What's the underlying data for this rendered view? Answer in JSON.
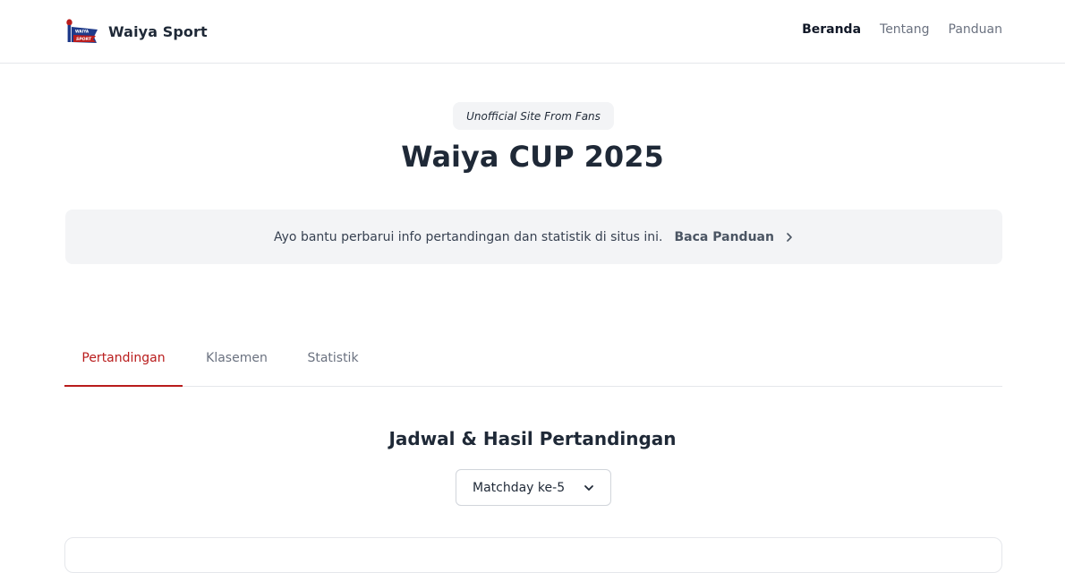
{
  "header": {
    "brand_name": "Waiya Sport",
    "logo_text_top": "WAIYA",
    "logo_text_bottom": "SPORT",
    "nav": [
      {
        "label": "Beranda",
        "active": true
      },
      {
        "label": "Tentang",
        "active": false
      },
      {
        "label": "Panduan",
        "active": false
      }
    ]
  },
  "hero": {
    "badge": "Unofficial Site From Fans",
    "title": "Waiya CUP 2025"
  },
  "notice": {
    "text": "Ayo bantu perbarui info pertandingan dan statistik di situs ini.",
    "link_label": "Baca Panduan",
    "link_icon": "chevron-right-icon"
  },
  "tabs": [
    {
      "label": "Pertandingan",
      "active": true
    },
    {
      "label": "Klasemen",
      "active": false
    },
    {
      "label": "Statistik",
      "active": false
    }
  ],
  "matches": {
    "section_title": "Jadwal & Hasil Pertandingan",
    "matchday_selected": "Matchday ke-5",
    "select_icon": "chevron-down-icon"
  },
  "colors": {
    "accent": "#b91c1c",
    "text_dark": "#1f2937",
    "muted": "#6b7280",
    "panel_bg": "#f3f4f6"
  }
}
